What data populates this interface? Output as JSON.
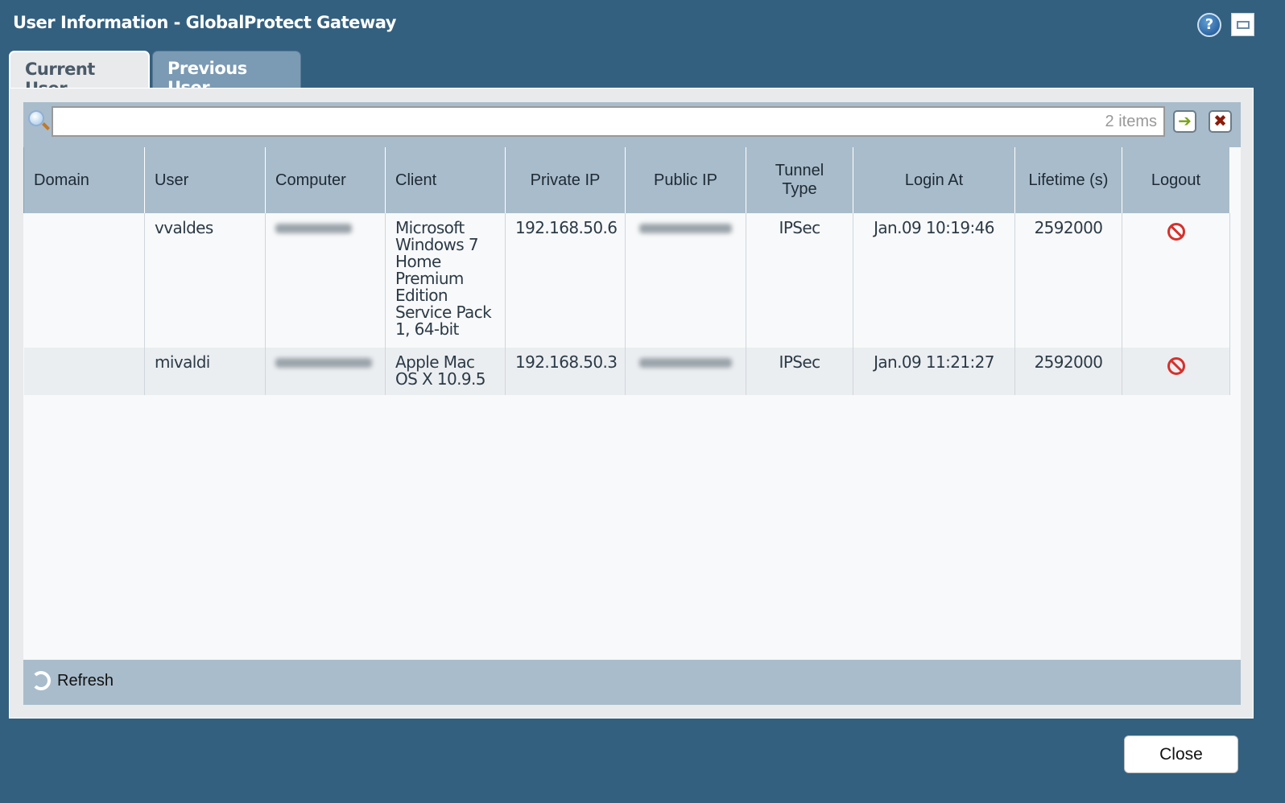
{
  "window": {
    "title": "User Information - GlobalProtect Gateway"
  },
  "tabs": [
    {
      "label": "Current User",
      "active": true
    },
    {
      "label": "Previous User",
      "active": false
    }
  ],
  "search": {
    "value": "",
    "count_label": "2 items"
  },
  "table": {
    "columns": [
      "Domain",
      "User",
      "Computer",
      "Client",
      "Private IP",
      "Public IP",
      "Tunnel Type",
      "Login At",
      "Lifetime (s)",
      "Logout"
    ],
    "rows": [
      {
        "domain": "",
        "user": "vvaldes",
        "computer": "",
        "client": "Microsoft Windows 7 Home Premium Edition Service Pack 1, 64-bit",
        "private_ip": "192.168.50.6",
        "public_ip": "",
        "tunnel_type": "IPSec",
        "login_at": "Jan.09 10:19:46",
        "lifetime": "2592000"
      },
      {
        "domain": "",
        "user": "mivaldi",
        "computer": "",
        "client": "Apple Mac OS X 10.9.5",
        "private_ip": "192.168.50.3",
        "public_ip": "",
        "tunnel_type": "IPSec",
        "login_at": "Jan.09 11:21:27",
        "lifetime": "2592000"
      }
    ]
  },
  "footer": {
    "refresh_label": "Refresh"
  },
  "close_label": "Close",
  "icons": {
    "help": "?"
  }
}
